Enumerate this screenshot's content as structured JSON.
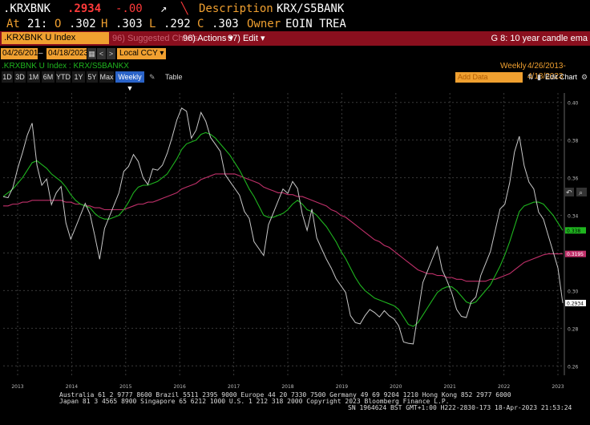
{
  "header": {
    "ticker": ".KRXBNK",
    "price": ".2934",
    "change": "-.00",
    "description_label": "Description",
    "description_value": "KRX/S5BANK",
    "at_label": "At",
    "at_time": "21:",
    "open_label": "O",
    "open_value": ".302",
    "high_label": "H",
    "high_value": ".303",
    "low_label": "L",
    "low_value": ".292",
    "close_label": "C",
    "close_value": ".303",
    "owner_label": "Owner",
    "owner_value": "EOIN TREA"
  },
  "toolbar": {
    "security": ".KRXBNK U Index",
    "suggested_charts": "96) Suggested Charts",
    "actions": "96) Actions ▾",
    "edit": "97) Edit ▾",
    "chart_title": "G 8: 10 year candle ema"
  },
  "range": {
    "start_date": "04/26/2013",
    "end_date": "04/18/2023",
    "ccy": "Local CCY",
    "ccy_arrow": "▾",
    "prev": "<",
    "next": ">",
    "cal": "▦"
  },
  "legend": {
    "series_label": ".KRXBNK U Index : KRX/S5BANKX",
    "freq": "Weekly",
    "period": "4/26/2013-4/18/2023"
  },
  "periods": [
    {
      "label": "1D",
      "active": false
    },
    {
      "label": "3D",
      "active": false
    },
    {
      "label": "1M",
      "active": false
    },
    {
      "label": "6M",
      "active": false
    },
    {
      "label": "YTD",
      "active": false
    },
    {
      "label": "1Y",
      "active": false
    },
    {
      "label": "5Y",
      "active": false
    },
    {
      "label": "Max",
      "active": false
    },
    {
      "label": "Weekly ▼",
      "active": true
    }
  ],
  "controls": {
    "draw_icon": "✎",
    "table": "Table",
    "add_data": "Add Data",
    "edit_chart": "Edit Chart",
    "gear": "⚙"
  },
  "chart_data": {
    "type": "line",
    "ylim": [
      0.255,
      0.405
    ],
    "y_ticks": [
      "0.40",
      "0.38",
      "0.36",
      "0.34",
      "0.32",
      "0.30",
      "0.28",
      "0.26"
    ],
    "x_ticks": [
      "2013",
      "2014",
      "2015",
      "2016",
      "2017",
      "2018",
      "2019",
      "2020",
      "2021",
      "2022",
      "2023"
    ],
    "last_price_label": "0.2934",
    "ema_short_label": "0.338",
    "ema_long_label": "0.3195",
    "colors": {
      "price": "#c8c8c8",
      "ema_short": "#1fb51f",
      "ema_long": "#c0306a",
      "grid": "#3a3a3a"
    },
    "series": [
      {
        "values": [
          0.35,
          0.352,
          0.356,
          0.365,
          0.372,
          0.38,
          0.385,
          0.37,
          0.358,
          0.36,
          0.345,
          0.35,
          0.352,
          0.34,
          0.33,
          0.335,
          0.34,
          0.345,
          0.338,
          0.325,
          0.32,
          0.335,
          0.34,
          0.345,
          0.35,
          0.36,
          0.37,
          0.375,
          0.37,
          0.36,
          0.355,
          0.362,
          0.36,
          0.37,
          0.375,
          0.382,
          0.39,
          0.395,
          0.392,
          0.385,
          0.388,
          0.396,
          0.39,
          0.38,
          0.375,
          0.37,
          0.365,
          0.36,
          0.355,
          0.35,
          0.34,
          0.335,
          0.33,
          0.325,
          0.32,
          0.335,
          0.34,
          0.345,
          0.35,
          0.355,
          0.36,
          0.355,
          0.34,
          0.33,
          0.34,
          0.332,
          0.325,
          0.318,
          0.312,
          0.305,
          0.3,
          0.295,
          0.29,
          0.285,
          0.283,
          0.286,
          0.288,
          0.285,
          0.29,
          0.292,
          0.288,
          0.285,
          0.28,
          0.27,
          0.268,
          0.275,
          0.29,
          0.305,
          0.31,
          0.315,
          0.32,
          0.315,
          0.308,
          0.3,
          0.29,
          0.285,
          0.283,
          0.29,
          0.3,
          0.31,
          0.315,
          0.32,
          0.33,
          0.34,
          0.35,
          0.36,
          0.375,
          0.382,
          0.365,
          0.355,
          0.35,
          0.345,
          0.34,
          0.33,
          0.32,
          0.31,
          0.2934
        ]
      },
      {
        "values": [
          0.35,
          0.352,
          0.354,
          0.357,
          0.36,
          0.364,
          0.368,
          0.369,
          0.367,
          0.365,
          0.362,
          0.36,
          0.358,
          0.355,
          0.351,
          0.348,
          0.346,
          0.345,
          0.344,
          0.341,
          0.339,
          0.338,
          0.338,
          0.339,
          0.34,
          0.343,
          0.347,
          0.352,
          0.355,
          0.356,
          0.356,
          0.357,
          0.358,
          0.36,
          0.362,
          0.366,
          0.37,
          0.375,
          0.378,
          0.379,
          0.38,
          0.383,
          0.384,
          0.383,
          0.381,
          0.378,
          0.375,
          0.372,
          0.368,
          0.364,
          0.359,
          0.354,
          0.35,
          0.345,
          0.34,
          0.339,
          0.339,
          0.34,
          0.341,
          0.343,
          0.346,
          0.348,
          0.346,
          0.343,
          0.342,
          0.34,
          0.337,
          0.334,
          0.33,
          0.326,
          0.321,
          0.317,
          0.312,
          0.307,
          0.303,
          0.3,
          0.298,
          0.296,
          0.295,
          0.294,
          0.293,
          0.292,
          0.29,
          0.286,
          0.282,
          0.281,
          0.283,
          0.287,
          0.291,
          0.295,
          0.299,
          0.301,
          0.302,
          0.302,
          0.3,
          0.297,
          0.294,
          0.293,
          0.294,
          0.297,
          0.3,
          0.303,
          0.308,
          0.313,
          0.319,
          0.326,
          0.334,
          0.342,
          0.345,
          0.346,
          0.347,
          0.347,
          0.346,
          0.343,
          0.34,
          0.336,
          0.332
        ]
      },
      {
        "values": [
          0.345,
          0.345,
          0.346,
          0.346,
          0.347,
          0.347,
          0.348,
          0.348,
          0.348,
          0.348,
          0.348,
          0.348,
          0.348,
          0.347,
          0.347,
          0.346,
          0.346,
          0.345,
          0.345,
          0.344,
          0.344,
          0.343,
          0.343,
          0.343,
          0.343,
          0.343,
          0.344,
          0.345,
          0.346,
          0.346,
          0.347,
          0.347,
          0.348,
          0.349,
          0.35,
          0.351,
          0.352,
          0.354,
          0.355,
          0.356,
          0.357,
          0.359,
          0.36,
          0.361,
          0.362,
          0.362,
          0.362,
          0.362,
          0.362,
          0.361,
          0.36,
          0.359,
          0.358,
          0.357,
          0.355,
          0.354,
          0.353,
          0.352,
          0.352,
          0.351,
          0.351,
          0.35,
          0.35,
          0.349,
          0.348,
          0.347,
          0.346,
          0.345,
          0.343,
          0.342,
          0.34,
          0.339,
          0.337,
          0.335,
          0.333,
          0.331,
          0.329,
          0.327,
          0.326,
          0.324,
          0.323,
          0.321,
          0.319,
          0.317,
          0.315,
          0.313,
          0.311,
          0.31,
          0.309,
          0.309,
          0.308,
          0.308,
          0.307,
          0.307,
          0.306,
          0.306,
          0.305,
          0.305,
          0.305,
          0.305,
          0.305,
          0.306,
          0.306,
          0.307,
          0.308,
          0.309,
          0.311,
          0.313,
          0.315,
          0.316,
          0.317,
          0.318,
          0.319,
          0.3195,
          0.3195,
          0.3195,
          0.3195
        ]
      }
    ]
  },
  "footer": {
    "line1": "Australia 61 2 9777 8600 Brazil 5511 2395 9000 Europe 44 20 7330 7500 Germany 49 69 9204 1210 Hong Kong 852 2977 6000",
    "line2": "Japan 81 3 4565 8900        Singapore 65 6212 1000         U.S. 1 212 318 2000          Copyright 2023 Bloomberg Finance L.P.",
    "line3": "SN 1964624 BST  GMT+1:00 H222-2830-173 18-Apr-2023 21:53:24"
  }
}
